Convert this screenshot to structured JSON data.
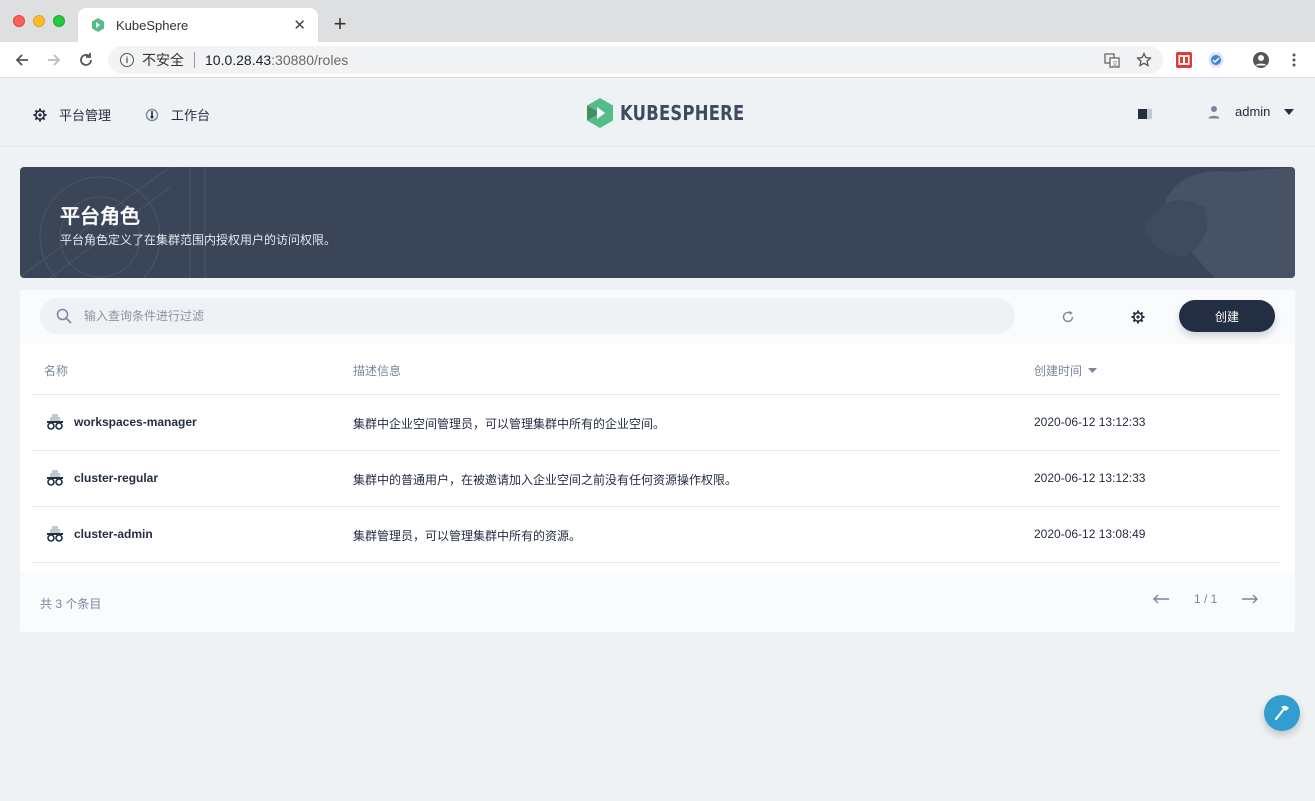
{
  "browser": {
    "tab_title": "KubeSphere",
    "new_tab": "+",
    "url_security": "不安全",
    "url_host": "10.0.28.43",
    "url_path": ":30880/roles"
  },
  "header": {
    "nav_platform": "平台管理",
    "nav_workbench": "工作台",
    "logo_text": "KUBESPHERE",
    "username": "admin"
  },
  "banner": {
    "title": "平台角色",
    "description": "平台角色定义了在集群范围内授权用户的访问权限。"
  },
  "toolbar": {
    "search_placeholder": "输入查询条件进行过滤",
    "create_label": "创建"
  },
  "table": {
    "columns": {
      "name": "名称",
      "description": "描述信息",
      "created": "创建时间"
    },
    "rows": [
      {
        "name": "workspaces-manager",
        "description": "集群中企业空间管理员，可以管理集群中所有的企业空间。",
        "created": "2020-06-12 13:12:33"
      },
      {
        "name": "cluster-regular",
        "description": "集群中的普通用户，在被邀请加入企业空间之前没有任何资源操作权限。",
        "created": "2020-06-12 13:12:33"
      },
      {
        "name": "cluster-admin",
        "description": "集群管理员，可以管理集群中所有的资源。",
        "created": "2020-06-12 13:08:49"
      }
    ]
  },
  "footer": {
    "total": "共 3 个条目",
    "page": "1 / 1"
  },
  "colors": {
    "banner_bg": "#3a4558",
    "primary_dark": "#242e42",
    "logo_green": "#55bc8a",
    "fab_blue": "#329dce"
  }
}
